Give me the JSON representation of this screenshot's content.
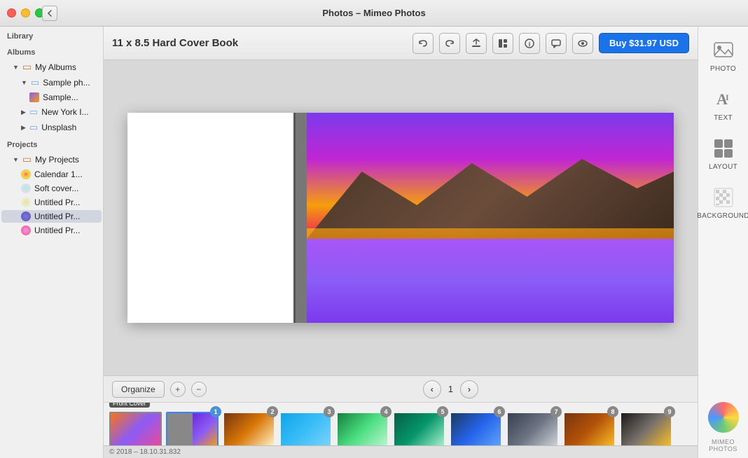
{
  "titleBar": {
    "title": "Photos – Mimeo Photos"
  },
  "sidebar": {
    "libraryLabel": "Library",
    "albumsLabel": "Albums",
    "myAlbums": "My Albums",
    "samplePh": "Sample ph...",
    "sampleItem": "Sample...",
    "newYorkI": "New York I...",
    "unsplash": "Unsplash",
    "projectsLabel": "Projects",
    "myProjects": "My Projects",
    "calendar1": "Calendar 1...",
    "softCover": "Soft cover...",
    "untitled1": "Untitled Pr...",
    "untitled2": "Untitled Pr...",
    "untitled3": "Untitled Pr..."
  },
  "toolbar": {
    "bookTitle": "11 x 8.5 Hard Cover Book",
    "undoLabel": "↩",
    "redoLabel": "↪",
    "uploadLabel": "⬆",
    "layoutLabel": "▤",
    "infoLabel": "ℹ",
    "chatLabel": "💬",
    "eyeLabel": "👁",
    "buyLabel": "Buy $31.97 USD"
  },
  "canvas": {
    "pageLabel": "1"
  },
  "navBar": {
    "organizeLabel": "Organize",
    "addLabel": "+",
    "removeLabel": "−",
    "prevLabel": "‹",
    "nextLabel": "›",
    "pageNum": "1"
  },
  "thumbnails": [
    {
      "id": "front-cover",
      "label": "Front Cover",
      "badge": "",
      "colorClass": "tp-1",
      "selected": false,
      "isCover": true
    },
    {
      "id": "page-1",
      "label": "",
      "badge": "1",
      "colorClass": "tp-page2",
      "selected": true,
      "isCover": false
    },
    {
      "id": "page-2",
      "label": "",
      "badge": "2",
      "colorClass": "tp-2",
      "selected": false,
      "isCover": false
    },
    {
      "id": "page-3",
      "label": "",
      "badge": "3",
      "colorClass": "tp-3",
      "selected": false,
      "isCover": false
    },
    {
      "id": "page-4",
      "label": "",
      "badge": "4",
      "colorClass": "tp-4",
      "selected": false,
      "isCover": false
    },
    {
      "id": "page-5",
      "label": "",
      "badge": "5",
      "colorClass": "tp-5",
      "selected": false,
      "isCover": false
    },
    {
      "id": "page-6",
      "label": "",
      "badge": "6",
      "colorClass": "tp-6",
      "selected": false,
      "isCover": false
    },
    {
      "id": "page-7",
      "label": "",
      "badge": "7",
      "colorClass": "tp-7",
      "selected": false,
      "isCover": false
    },
    {
      "id": "page-8",
      "label": "",
      "badge": "8",
      "colorClass": "tp-8",
      "selected": false,
      "isCover": false
    },
    {
      "id": "page-9",
      "label": "",
      "badge": "9",
      "colorClass": "tp-9",
      "selected": false,
      "isCover": false
    }
  ],
  "rightPanel": {
    "photoLabel": "PHOTO",
    "textLabel": "TEXT",
    "layoutLabel": "LAYOUT",
    "backgroundLabel": "BACKGROUND",
    "mimeoLabel": "mimeo\nPhotos"
  },
  "statusBar": {
    "text": "© 2018 – 18.10.31.832"
  }
}
